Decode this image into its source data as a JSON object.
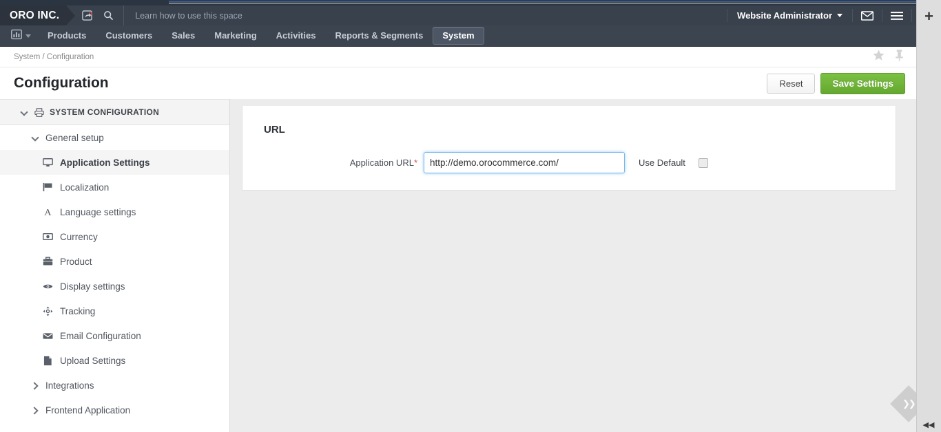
{
  "header": {
    "logo": "ORO INC.",
    "hint_text": "Learn how to use this space",
    "share_icon": "share-arrow-icon",
    "search_icon": "search-icon",
    "user_menu": "Website Administrator",
    "mail_icon": "envelope-icon",
    "menu_icon": "hamburger-menu-icon",
    "help_icon": "help-circle-icon"
  },
  "nav": {
    "grid_icon": "dashboard-chart-icon",
    "items": [
      {
        "label": "Products",
        "active": false
      },
      {
        "label": "Customers",
        "active": false
      },
      {
        "label": "Sales",
        "active": false
      },
      {
        "label": "Marketing",
        "active": false
      },
      {
        "label": "Activities",
        "active": false
      },
      {
        "label": "Reports & Segments",
        "active": false
      },
      {
        "label": "System",
        "active": true
      }
    ]
  },
  "breadcrumb": {
    "text": "System / Configuration",
    "star_icon": "star-favorite-icon",
    "pin_icon": "pin-icon"
  },
  "page": {
    "title": "Configuration",
    "reset_label": "Reset",
    "save_label": "Save Settings"
  },
  "sidebar": {
    "section": {
      "label": "SYSTEM CONFIGURATION",
      "icon": "print-config-icon",
      "expanded": true
    },
    "group": {
      "label": "General setup",
      "expanded": true
    },
    "items": [
      {
        "label": "Application Settings",
        "icon": "monitor-icon",
        "active": true
      },
      {
        "label": "Localization",
        "icon": "flag-icon",
        "active": false
      },
      {
        "label": "Language settings",
        "icon": "letter-a-icon",
        "active": false
      },
      {
        "label": "Currency",
        "icon": "banknote-icon",
        "active": false
      },
      {
        "label": "Product",
        "icon": "briefcase-icon",
        "active": false
      },
      {
        "label": "Display settings",
        "icon": "eye-icon",
        "active": false
      },
      {
        "label": "Tracking",
        "icon": "move-crosshair-icon",
        "active": false
      },
      {
        "label": "Email Configuration",
        "icon": "envelope-icon",
        "active": false
      },
      {
        "label": "Upload Settings",
        "icon": "file-icon",
        "active": false
      }
    ],
    "collapsed_groups": [
      {
        "label": "Integrations"
      },
      {
        "label": "Frontend Application"
      }
    ]
  },
  "content": {
    "card_title": "URL",
    "field_label": "Application URL",
    "required_mark": "*",
    "url_value": "http://demo.orocommerce.com/",
    "url_placeholder": "",
    "use_default_label": "Use Default",
    "use_default_checked": false
  },
  "right_panel": {
    "plus_icon": "add-plus-icon",
    "collapse_icon": "collapse-arrows-icon",
    "bottom_icon": "collapse-left-icon"
  },
  "colors": {
    "header_bg": "#39414d",
    "nav_bg": "#3b444f",
    "logo_bg": "#2c333d",
    "save_green": "#6fb536",
    "focus_blue": "#78b6e8",
    "required_red": "#d9534f"
  }
}
